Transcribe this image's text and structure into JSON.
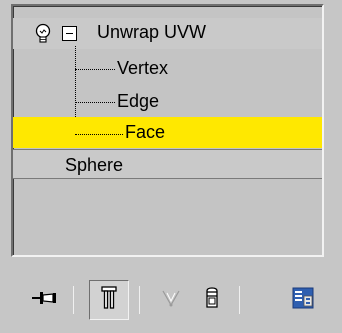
{
  "modifier_stack": {
    "items": [
      {
        "label": "Unwrap UVW",
        "kind": "modifier",
        "expanded": true
      },
      {
        "label": "Vertex",
        "kind": "sub-object"
      },
      {
        "label": "Edge",
        "kind": "sub-object"
      },
      {
        "label": "Face",
        "kind": "sub-object",
        "selected": true
      },
      {
        "label": "Sphere",
        "kind": "base-object"
      }
    ]
  },
  "toolbar": {
    "buttons": [
      {
        "icon": "pin-stack-icon"
      },
      {
        "icon": "show-end-result-icon",
        "pressed": true
      },
      {
        "icon": "make-unique-icon",
        "disabled": true
      },
      {
        "icon": "remove-modifier-icon"
      },
      {
        "icon": "configure-modifier-sets-icon"
      }
    ]
  },
  "colors": {
    "panel_bg": "#c6c6c6",
    "selection": "#ffe800"
  }
}
